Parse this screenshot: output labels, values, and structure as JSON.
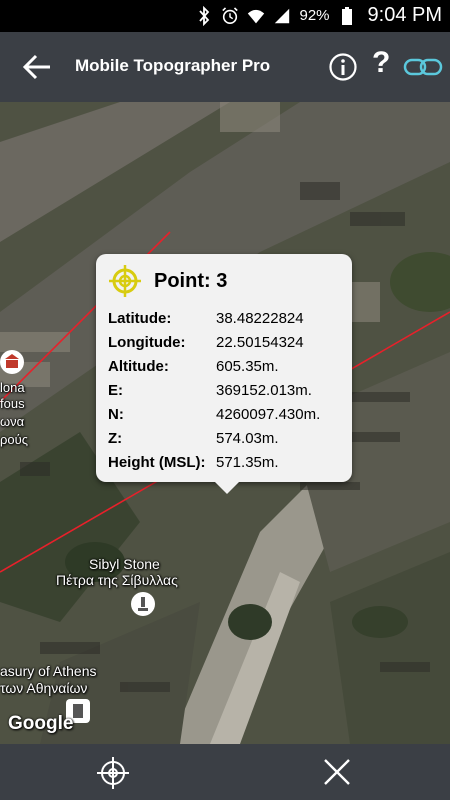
{
  "status_bar": {
    "battery": "92%",
    "time": "9:04 PM",
    "icons": [
      "bluetooth-icon",
      "alarm-icon",
      "wifi-icon",
      "signal-icon",
      "battery-icon"
    ]
  },
  "app_bar": {
    "title": "Mobile Topographer Pro",
    "icons": [
      "back-arrow-icon",
      "info-icon",
      "help-icon",
      "link-icon"
    ]
  },
  "popup": {
    "title": "Point: 3",
    "rows": [
      {
        "label": "Latitude:",
        "value": "38.48222824"
      },
      {
        "label": "Longitude:",
        "value": "22.50154324"
      },
      {
        "label": "Altitude:",
        "value": "605.35m."
      },
      {
        "label": "E:",
        "value": "369152.013m."
      },
      {
        "label": "N:",
        "value": "4260097.430m."
      },
      {
        "label": "Z:",
        "value": "574.03m."
      },
      {
        "label": "Height (MSL):",
        "value": "571.35m."
      }
    ]
  },
  "map": {
    "labels": {
      "sibyl_en": "Sibyl Stone",
      "sibyl_gr": "Πέτρα της Σίβυλλας",
      "treasury_en": "asury of Athens",
      "treasury_gr": "των Αθηναίων",
      "left_1": "lona",
      "left_2": "fous",
      "left_3": "ωνα",
      "left_4": "ρούς"
    },
    "attribution": "Google",
    "line_color": "#e8202a",
    "marker_color": "#f4e21a"
  },
  "bottom_bar": {
    "icons": [
      "crosshair-icon",
      "close-icon"
    ]
  }
}
